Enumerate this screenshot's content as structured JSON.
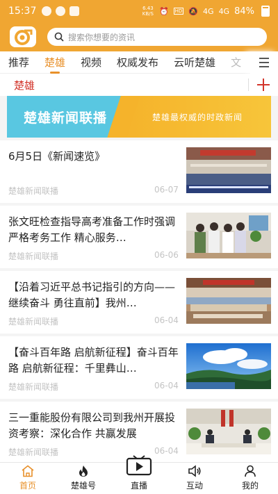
{
  "status_bar": {
    "time": "15:37",
    "net_speed_value": "6.43",
    "net_speed_unit": "KB/S",
    "signal_labels": [
      "4G",
      "4G"
    ],
    "battery": "84%"
  },
  "header": {
    "search_placeholder": "搜索你想要的资讯",
    "accent_color": "#f0a632"
  },
  "tabs": [
    {
      "label": "推荐",
      "active": false
    },
    {
      "label": "楚雄",
      "active": true
    },
    {
      "label": "视频",
      "active": false
    },
    {
      "label": "权威发布",
      "active": false
    },
    {
      "label": "云听楚雄",
      "active": false
    },
    {
      "label": "文",
      "active": false
    }
  ],
  "channel": {
    "title": "楚雄"
  },
  "banner": {
    "left_text": "楚雄新闻联播",
    "right_text": "楚雄最权威的时政新闻"
  },
  "news": [
    {
      "title": "6月5日《新闻速览》",
      "source": "楚雄新闻联播",
      "date": "06-07",
      "thumb": "meeting-hall"
    },
    {
      "title": "张文旺检查指导高考准备工作时强调 严格考务工作 精心服务…",
      "source": "楚雄新闻联播",
      "date": "06-06",
      "thumb": "inspection"
    },
    {
      "title": "【沿着习近平总书记指引的方向——继续奋斗 勇往直前】我州…",
      "source": "楚雄新闻联播",
      "date": "06-04",
      "thumb": "conference"
    },
    {
      "title": "【奋斗百年路 启航新征程】奋斗百年路 启航新征程：千里彝山…",
      "source": "楚雄新闻联播",
      "date": "06-04",
      "thumb": "landscape"
    },
    {
      "title": "三一重能股份有限公司到我州开展投资考察：深化合作 共赢发展",
      "source": "楚雄新闻联播",
      "date": "06-04",
      "thumb": "meeting-room"
    }
  ],
  "bottom_nav": [
    {
      "label": "首页",
      "icon": "home-icon",
      "active": true
    },
    {
      "label": "楚雄号",
      "icon": "flame-icon",
      "active": false
    },
    {
      "label": "直播",
      "icon": "tv-play-icon",
      "active": false
    },
    {
      "label": "互动",
      "icon": "speaker-icon",
      "active": false
    },
    {
      "label": "我的",
      "icon": "person-icon",
      "active": false
    }
  ],
  "colors": {
    "accent": "#f0a632",
    "active_tab": "#e8902a",
    "channel_red": "#d2342a",
    "banner_blue": "#59c7e1",
    "banner_orange": "#f5b32b"
  }
}
